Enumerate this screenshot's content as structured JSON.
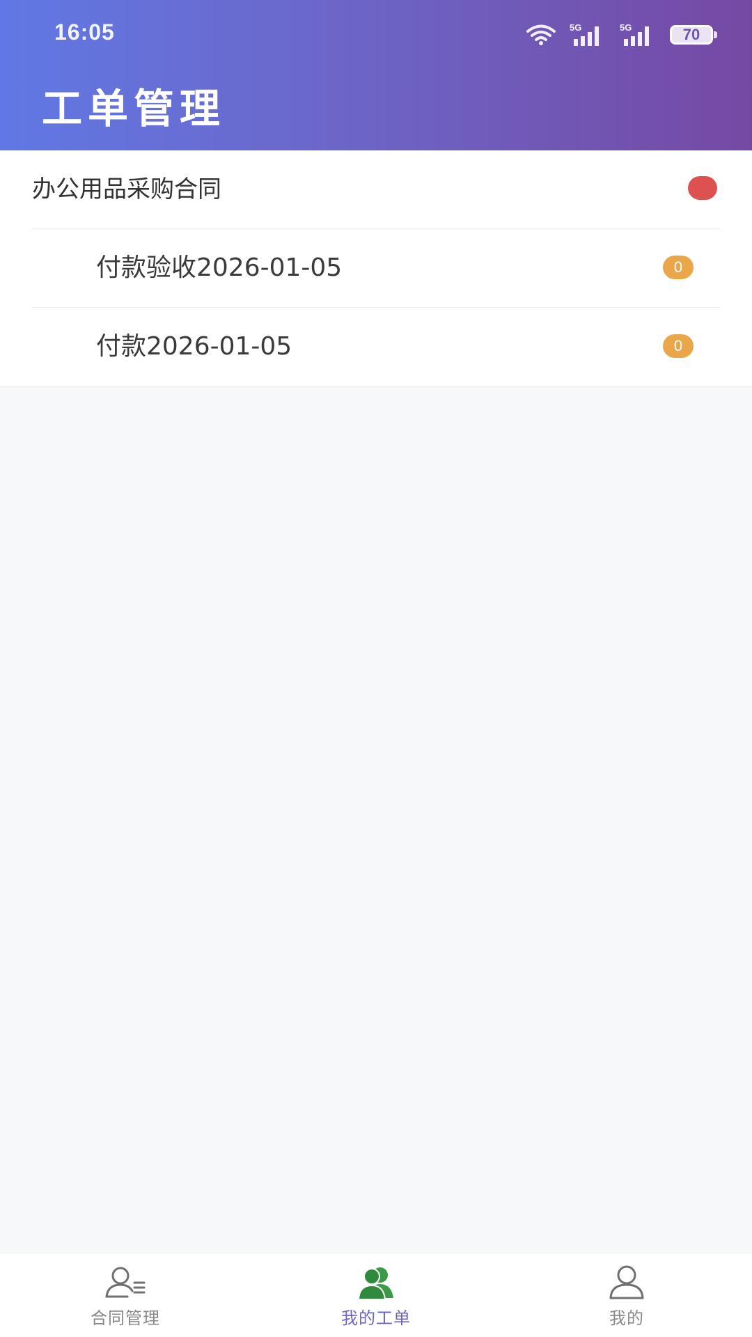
{
  "status_bar": {
    "time": "16:05",
    "battery": "70",
    "network_1": "5G",
    "network_2": "5G"
  },
  "header": {
    "title": "工单管理"
  },
  "list": {
    "group": {
      "title": "办公用品采购合同",
      "dot_color": "#de5151"
    },
    "items": [
      {
        "label": "付款验收2026-01-05",
        "count": "0"
      },
      {
        "label": "付款2026-01-05",
        "count": "0"
      }
    ]
  },
  "tabbar": {
    "tabs": [
      {
        "label": "合同管理",
        "icon": "contract-user-icon",
        "active": false
      },
      {
        "label": "我的工单",
        "icon": "users-icon",
        "active": true
      },
      {
        "label": "我的",
        "icon": "user-icon",
        "active": false
      }
    ],
    "active_color": "#6b64c8",
    "active_icon_color": "#3a9a48"
  },
  "colors": {
    "header_gradient_start": "#6178e4",
    "header_gradient_end": "#7549a3",
    "badge": "#eaa74a"
  }
}
